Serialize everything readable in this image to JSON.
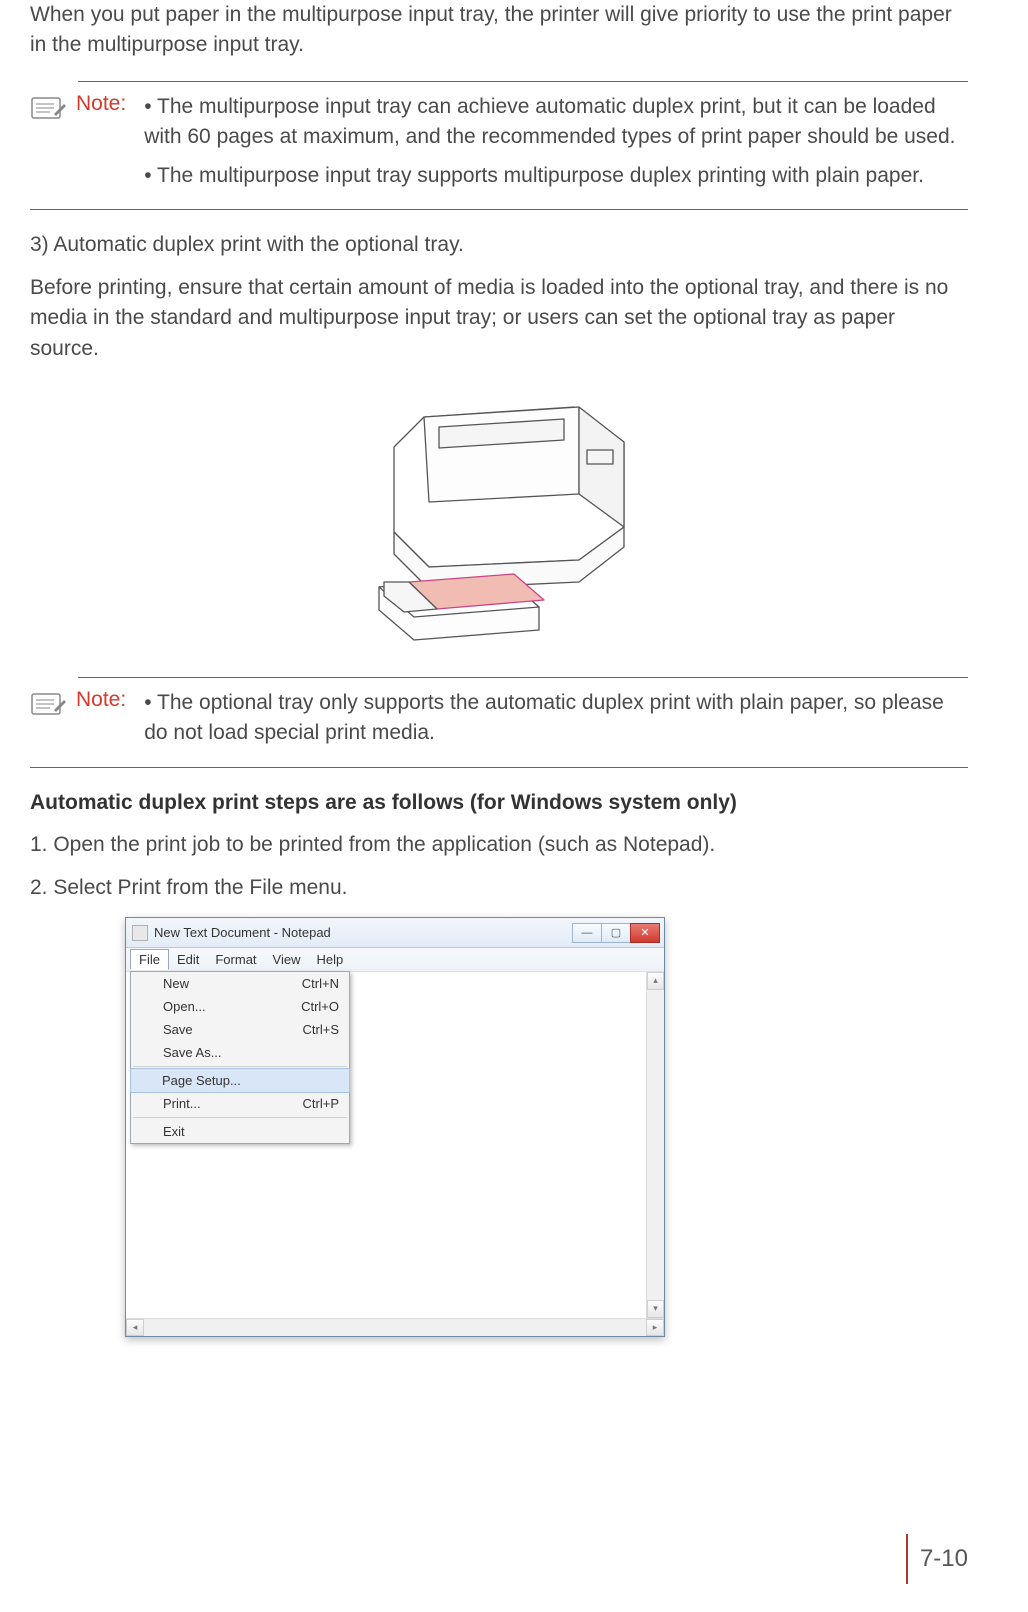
{
  "intro_paragraph": "When you put paper in the multipurpose input tray, the printer will give priority to use the print paper in the multipurpose input tray.",
  "note1": {
    "label": "Note:",
    "bullet1": "• The multipurpose input tray can achieve automatic duplex print, but it can be loaded with 60 pages at maximum, and the recommended types of print paper should be used.",
    "bullet2": "• The multipurpose input tray supports multipurpose duplex printing with plain paper."
  },
  "step3_heading": "3) Automatic duplex print with the optional tray.",
  "step3_body": "Before printing, ensure that certain amount of media is loaded into the optional tray, and there is no media in the standard and multipurpose input tray; or users can set the optional tray as paper source.",
  "note2": {
    "label": "Note:",
    "bullet1": "• The optional tray only supports the automatic duplex print with plain paper, so please do not load special print media."
  },
  "auto_heading": "Automatic duplex print steps are as follows (for Windows system only)",
  "step1": "1. Open the print job to be printed from the application (such as Notepad).",
  "step2": "2. Select Print from the File menu.",
  "notepad": {
    "title": "New Text Document - Notepad",
    "menus": {
      "file": "File",
      "edit": "Edit",
      "format": "Format",
      "view": "View",
      "help": "Help"
    },
    "file_menu": {
      "new": "New",
      "new_sc": "Ctrl+N",
      "open": "Open...",
      "open_sc": "Ctrl+O",
      "save": "Save",
      "save_sc": "Ctrl+S",
      "save_as": "Save As...",
      "page_setup": "Page Setup...",
      "print": "Print...",
      "print_sc": "Ctrl+P",
      "exit": "Exit"
    },
    "win_btns": {
      "min": "—",
      "max": "▢",
      "close": "✕"
    },
    "arrows": {
      "up": "▴",
      "down": "▾",
      "left": "◂",
      "right": "▸"
    }
  },
  "page_number": "7-10"
}
